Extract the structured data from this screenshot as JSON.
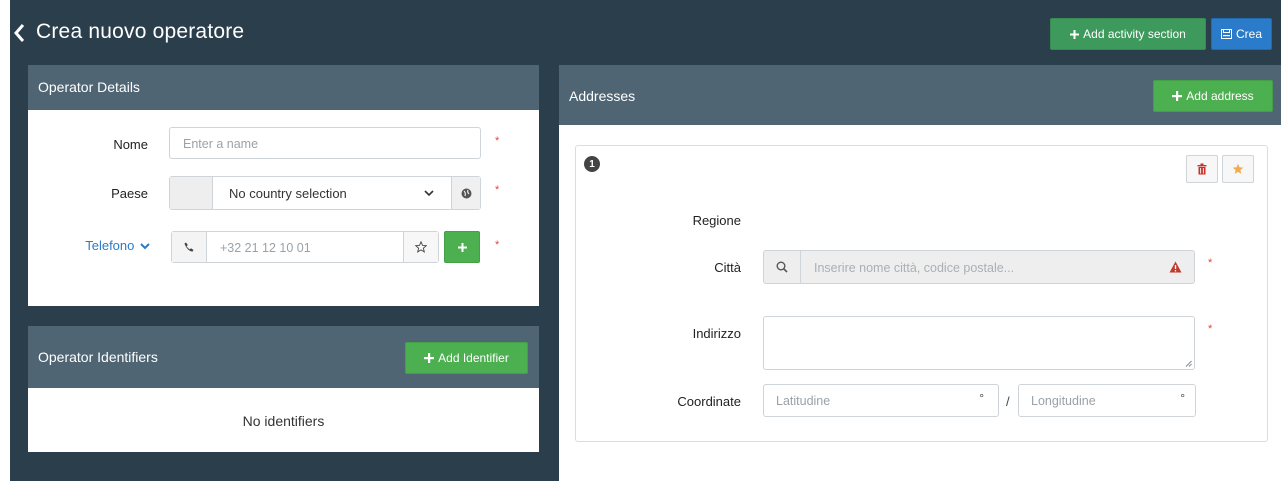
{
  "header": {
    "title": "Crea nuovo operatore",
    "add_activity_label": "Add activity section",
    "create_label": "Crea"
  },
  "operator_details": {
    "title": "Operator Details",
    "name_label": "Nome",
    "name_placeholder": "Enter a name",
    "country_label": "Paese",
    "country_value": "No country selection",
    "phone_label": "Telefono",
    "phone_placeholder": "+32 21 12 10 01",
    "required_mark": "*"
  },
  "operator_identifiers": {
    "title": "Operator Identifiers",
    "add_label": "Add Identifier",
    "empty_text": "No identifiers"
  },
  "addresses": {
    "title": "Addresses",
    "add_label": "Add address",
    "item_number": "1",
    "region_label": "Regione",
    "city_label": "Città",
    "city_placeholder": "Inserire nome città, codice postale...",
    "address_label": "Indirizzo",
    "coords_label": "Coordinate",
    "lat_placeholder": "Latitudine",
    "lon_placeholder": "Longitudine",
    "degree": "°",
    "slash": "/",
    "required_mark": "*"
  },
  "colors": {
    "background": "#2b3e4b",
    "panel_header": "#4f6574",
    "green": "#4caf50",
    "blue": "#2a7bc9",
    "required": "#e0463a"
  }
}
